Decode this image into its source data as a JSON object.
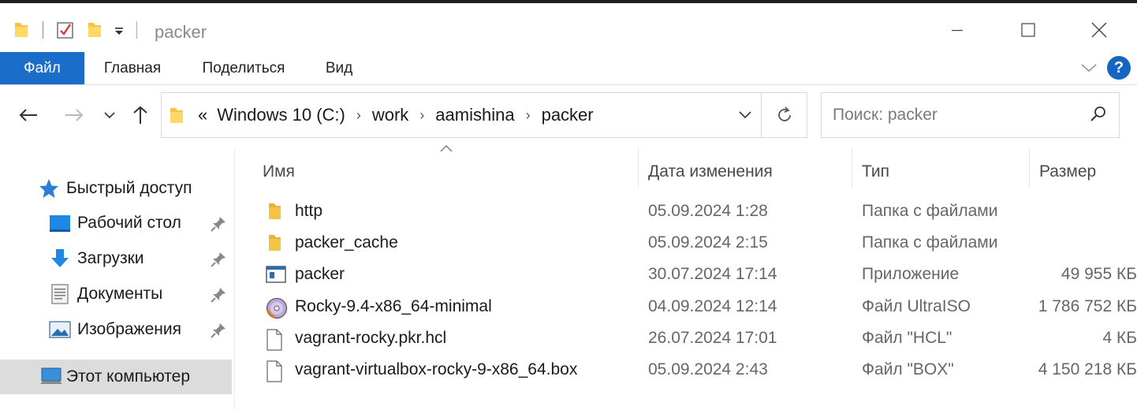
{
  "window": {
    "title": "packer",
    "quick_access": [
      "folder-icon",
      "checkbox-icon",
      "folder-icon",
      "dropdown-icon"
    ]
  },
  "ribbon": {
    "tabs": [
      "Файл",
      "Главная",
      "Поделиться",
      "Вид"
    ],
    "help_label": "?"
  },
  "address": {
    "overflow": "«",
    "crumbs": [
      "Windows 10 (C:)",
      "work",
      "aamishina",
      "packer"
    ],
    "separator": "›"
  },
  "search": {
    "placeholder": "Поиск: packer"
  },
  "nav": {
    "quick_access_label": "Быстрый доступ",
    "items": [
      {
        "label": "Рабочий стол",
        "icon": "desktop-icon",
        "pinned": true
      },
      {
        "label": "Загрузки",
        "icon": "download-icon",
        "pinned": true
      },
      {
        "label": "Документы",
        "icon": "documents-icon",
        "pinned": true
      },
      {
        "label": "Изображения",
        "icon": "pictures-icon",
        "pinned": true
      }
    ],
    "this_pc_label": "Этот компьютер"
  },
  "columns": {
    "name": "Имя",
    "date": "Дата изменения",
    "type": "Тип",
    "size": "Размер"
  },
  "files": [
    {
      "name": "http",
      "date": "05.09.2024 1:28",
      "type": "Папка с файлами",
      "size": "",
      "icon": "folder-icon"
    },
    {
      "name": "packer_cache",
      "date": "05.09.2024 2:15",
      "type": "Папка с файлами",
      "size": "",
      "icon": "folder-icon"
    },
    {
      "name": "packer",
      "date": "30.07.2024 17:14",
      "type": "Приложение",
      "size": "49 955 КБ",
      "icon": "application-icon"
    },
    {
      "name": "Rocky-9.4-x86_64-minimal",
      "date": "04.09.2024 12:14",
      "type": "Файл UltraISO",
      "size": "1 786 752 КБ",
      "icon": "disc-image-icon"
    },
    {
      "name": "vagrant-rocky.pkr.hcl",
      "date": "26.07.2024 17:01",
      "type": "Файл \"HCL\"",
      "size": "4 КБ",
      "icon": "file-icon"
    },
    {
      "name": "vagrant-virtualbox-rocky-9-x86_64.box",
      "date": "05.09.2024 2:43",
      "type": "Файл \"BOX\"",
      "size": "4 150 218 КБ",
      "icon": "file-icon"
    }
  ],
  "colors": {
    "accent": "#1a6ec9",
    "folder": "#f4c542",
    "selected": "#dcdcdc"
  }
}
